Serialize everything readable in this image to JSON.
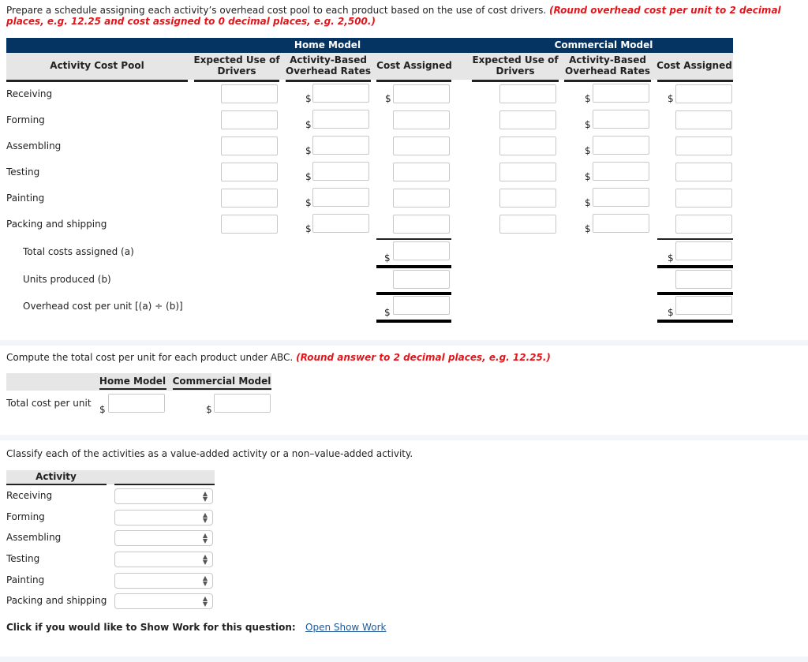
{
  "instructions": {
    "text": "Prepare a schedule assigning each activity’s overhead cost pool to each product based on the use of cost drivers.",
    "note": "(Round overhead cost per unit to 2 decimal places, e.g. 12.25 and cost assigned to 0 decimal places, e.g. 2,500.)"
  },
  "schedule": {
    "group_headers": [
      "Home Model",
      "Commercial Model"
    ],
    "col_activity": "Activity Cost Pool",
    "col_expected": "Expected Use of Drivers",
    "col_expected_l1": "Expected Use of",
    "col_expected_l2": "Drivers",
    "col_rates_l1": "Activity-Based",
    "col_rates_l2": "Overhead Rates",
    "col_cost": "Cost Assigned",
    "currency": "$",
    "rows": [
      "Receiving",
      "Forming",
      "Assembling",
      "Testing",
      "Painting",
      "Packing and shipping"
    ],
    "totals": {
      "total_costs": "Total costs assigned (a)",
      "units": "Units produced (b)",
      "per_unit": "Overhead cost per unit [(a) ÷ (b)]"
    }
  },
  "abc": {
    "prompt": "Compute the total cost per unit for each product under ABC.",
    "note": "(Round answer to 2 decimal places, e.g. 12.25.)",
    "col_home": "Home Model",
    "col_commercial": "Commercial Model",
    "row_label": "Total cost per unit",
    "currency": "$"
  },
  "classify": {
    "prompt": "Classify each of the activities as a value-added activity or a non–value-added activity.",
    "col_activity": "Activity",
    "rows": [
      "Receiving",
      "Forming",
      "Assembling",
      "Testing",
      "Painting",
      "Packing and shipping"
    ],
    "selected_value": ""
  },
  "show_work": {
    "label": "Click if you would like to Show Work for this question:",
    "link": "Open Show Work"
  }
}
